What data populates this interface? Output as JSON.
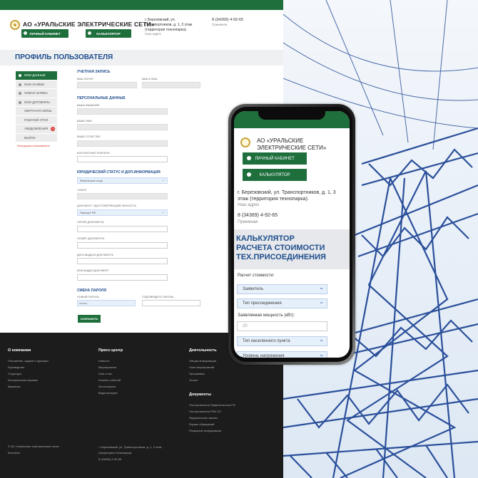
{
  "header": {
    "company": "АО «УРАЛЬСКИЕ ЭЛЕКТРИЧЕСКИЕ СЕТИ»",
    "btn_cabinet": "ЛИЧНЫЙ КАБИНЕТ",
    "btn_calculator": "КАЛЬКУЛЯТОР",
    "address": "г. Березовский, ул. Транспортников, д. 1, 3 этаж (территория технопарка).",
    "address_label": "Наш адрес",
    "phone": "8 (34369) 4-92-65",
    "phone_label": "Приемная"
  },
  "page_title": "ПРОФИЛЬ ПОЛЬЗОВАТЕЛЯ",
  "sidebar": {
    "items": [
      {
        "label": "МОИ ДАННЫЕ"
      },
      {
        "label": "МОИ ЗАЯВКИ"
      },
      {
        "label": "НОВАЯ ЗАЯВКА"
      },
      {
        "label": "МОИ ДОГОВОРЫ"
      },
      {
        "label": "ОБРАТНАЯ СВЯЗЬ"
      },
      {
        "label": "РАБОЧИЙ СТОЛ"
      },
      {
        "label": "УВЕДОМЛЕНИЯ",
        "badge": "11"
      },
      {
        "label": "ВЫЙТИ"
      }
    ],
    "instructions": "Инструкция пользователя"
  },
  "form": {
    "account_heading": "УЧЕТНАЯ ЗАПИСЬ",
    "login_label": "ВАШ ЛОГИН",
    "email_label": "ВАШ E-MAIL",
    "personal_heading": "ПЕРСОНАЛЬНЫЕ ДАННЫЕ",
    "surname_label": "ВАША ФАМИЛИЯ",
    "name_label": "ВАШЕ ИМЯ",
    "patronymic_label": "ВАШЕ ОТЧЕСТВО",
    "phone_label": "КОНТАКТНЫЙ ТЕЛЕФОН",
    "legal_heading": "ЮРИДИЧЕСКИЙ СТАТУС И ДОП.ИНФОРМАЦИЯ",
    "legal_status_value": "Физическое лицо",
    "snils_label": "СНИЛС",
    "doc_label": "ДОКУМЕНТ, УДОСТОВЕРЯЮЩИЙ ЛИЧНОСТЬ",
    "doc_value": "Паспорт РФ",
    "doc_series_label": "СЕРИЯ ДОКУМЕНТА",
    "doc_number_label": "НОМЕР ДОКУМЕНТА",
    "doc_date_label": "ДАТА ВЫДАЧИ ДОКУМЕНТА",
    "doc_issuer_label": "КЕМ ВЫДАН ДОКУМЕНТ",
    "password_heading": "СМЕНА ПАРОЛЯ",
    "new_password_label": "НОВЫЙ ПАРОЛЬ",
    "new_password_value": "••••••••",
    "confirm_password_label": "ПОДТВЕРДИТЕ ПАРОЛЬ",
    "save_label": "СОХРАНИТЬ"
  },
  "footer": {
    "col1_title": "О компании",
    "col1_items": [
      "Положение, задачи и функции",
      "Руководство",
      "Структура",
      "Историческая справка",
      "Вакансии"
    ],
    "col2_title": "Пресс-центр",
    "col2_items": [
      "Новости",
      "Мероприятия",
      "Сми о нас",
      "Анонсы событий",
      "Фотогалерея",
      "Видеогалерея"
    ],
    "col3_title": "Деятельность",
    "col3_items": [
      "Общая информация",
      "План мероприятий",
      "Программы",
      "Услуги"
    ],
    "col4_title": "Документы",
    "col4_items": [
      "Постановления Правительства РФ",
      "Постановления РЭК СО",
      "Федеральные законы",
      "Формы обращений",
      "Раскрытие информации"
    ],
    "copyright": "© АО «Уральские электрические сети»",
    "contacts": "Контакты",
    "address": "г. Березовский, ул. Транспортников, д. 1, 3 этаж (территория технопарка).",
    "phone": "8 (34369) 4-92-65"
  },
  "mobile": {
    "company": "АО «УРАЛЬСКИЕ ЭЛЕКТРИЧЕСКИЕ СЕТИ»",
    "btn_cabinet": "ЛИЧНЫЙ КАБИНЕТ",
    "btn_calculator": "КАЛЬКУЛЯТОР",
    "address": "г. Березовский, ул. Транспортников, д. 1, 3 этаж (территория технопарка).",
    "address_label": "Наш адрес",
    "phone": "8 (34369) 4-92-65",
    "phone_label": "Приемная",
    "calc_title": "КАЛЬКУЛЯТОР РАСЧЕТА СТОИМОСТИ ТЕХ.ПРИСОЕДИНЕНИЯ",
    "calc_label": "Расчет стоимости:",
    "select_applicant": "Заявитель",
    "select_connection": "Тип присоединения",
    "power_label": "Заявляемая мощность (кВт):",
    "power_value": "20",
    "select_locality": "Тип населенного пункта",
    "select_voltage": "Уровень напряжения"
  },
  "colors": {
    "brand_green": "#1f6f3d",
    "brand_blue": "#1f4e8c",
    "footer_bg": "#1c1c1c"
  }
}
